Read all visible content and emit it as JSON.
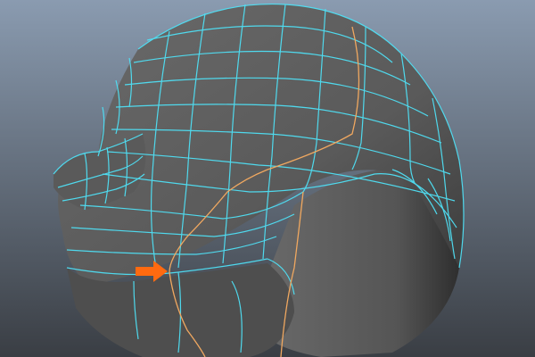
{
  "viewport": {
    "background_top": "#8a9bb0",
    "background_bottom": "#3a3e44",
    "shaded_surface_color": "#5e5e5e",
    "wireframe_color": "#4fe0f5",
    "selected_edge_loop_color": "#f0a860",
    "annotation_arrow_color": "#ff6a10"
  },
  "annotation": {
    "icon": "arrow-right-icon",
    "direction": "right"
  }
}
